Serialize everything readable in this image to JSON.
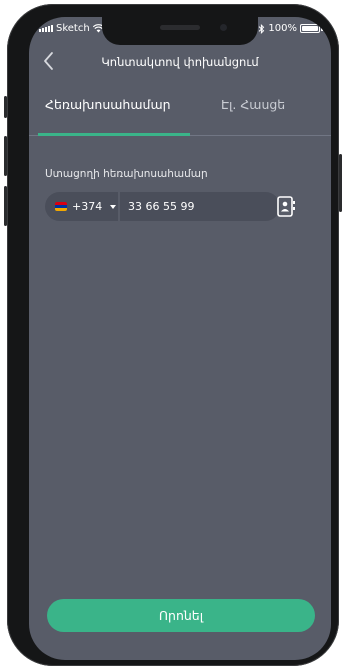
{
  "status_bar": {
    "carrier": "Sketch",
    "battery_percent": "100%"
  },
  "nav": {
    "title": "Կոնտակտով փոխանցում",
    "back_icon": "chevron-left-icon"
  },
  "tabs": [
    {
      "label": "Հեռախոսահամար",
      "active": true
    },
    {
      "label": "Էլ. Հասցե",
      "active": false
    }
  ],
  "form": {
    "phone_label": "Ստացողի հեռախոսահամար",
    "country_code": "+374",
    "phone_value": "33 66 55 99",
    "contacts_icon": "contact-book-icon"
  },
  "actions": {
    "next_label": "Որոնել"
  },
  "colors": {
    "accent": "#3ab489",
    "background": "#585c68",
    "field": "#4a4e5a"
  }
}
